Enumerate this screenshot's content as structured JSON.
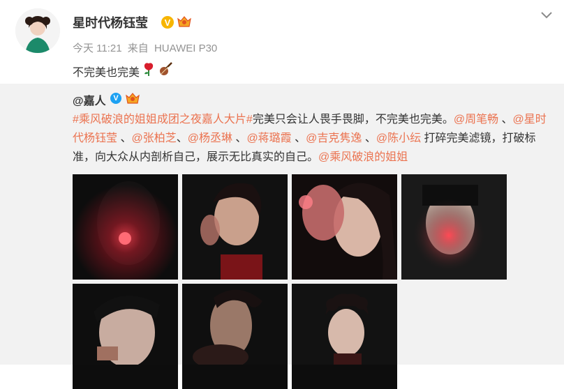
{
  "post": {
    "avatar_icon": "user-avatar",
    "username": "星时代杨钰莹",
    "verified_icon": "verified-v-badge",
    "member_icon": "vip-crown-icon",
    "time": "今天 11:21",
    "source_prefix": "来自",
    "source_device": "HUAWEI P30",
    "text": "不完美也完美",
    "emojis": [
      "rose-emoji",
      "violin-emoji"
    ],
    "menu_icon": "chevron-down-icon"
  },
  "repost": {
    "author": "@嘉人",
    "author_badge_icon": "blue-v-badge",
    "author_crown_icon": "vip-crown-icon",
    "segments": [
      {
        "text": "#乘风破浪的姐姐成团之夜嘉人大片#",
        "link": true
      },
      {
        "text": "完美只会让人畏手畏脚，不完美也完美。",
        "link": false
      },
      {
        "text": "@周笔畅",
        "link": true
      },
      {
        "text": " 、",
        "link": false
      },
      {
        "text": "@星时代杨钰莹",
        "link": true
      },
      {
        "text": " 、",
        "link": false
      },
      {
        "text": "@张柏芝",
        "link": true
      },
      {
        "text": "、",
        "link": false
      },
      {
        "text": "@杨丞琳",
        "link": true
      },
      {
        "text": " 、",
        "link": false
      },
      {
        "text": "@蒋璐霞",
        "link": true
      },
      {
        "text": " 、",
        "link": false
      },
      {
        "text": "@吉克隽逸",
        "link": true
      },
      {
        "text": " 、",
        "link": false
      },
      {
        "text": "@陈小纭",
        "link": true
      },
      {
        "text": " 打碎完美滤镜，打破标准，向大众从内剖析自己，展示无比真实的自己。",
        "link": false
      },
      {
        "text": "@乘风破浪的姐姐",
        "link": true
      }
    ],
    "photos": [
      "photo-1",
      "photo-2",
      "photo-3",
      "photo-4",
      "photo-5",
      "photo-6",
      "photo-7"
    ]
  },
  "colors": {
    "link": "#eb7350",
    "meta": "#939393",
    "repost_bg": "#f2f2f2",
    "gold_badge": "#f7b500",
    "blue_badge": "#1da1f2"
  }
}
